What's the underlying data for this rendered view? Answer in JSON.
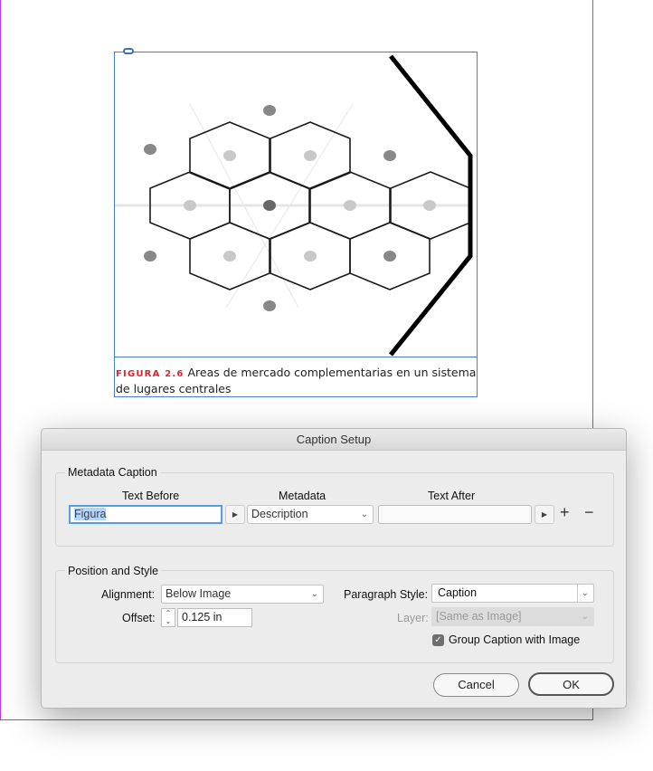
{
  "document": {
    "caption_label": "FIGURA 2.6",
    "caption_text": "Areas de mercado complementarias en un sistema de lugares centrales",
    "guide_color": "#b43cf0",
    "frame_color": "#4a7fd0"
  },
  "dialog": {
    "title": "Caption Setup",
    "metadata_caption": {
      "legend": "Metadata Caption",
      "text_before_header": "Text Before",
      "metadata_header": "Metadata",
      "text_after_header": "Text After",
      "text_before_value": "Figura",
      "metadata_value": "Description",
      "text_after_value": "",
      "add_label": "+",
      "remove_label": "−"
    },
    "position_and_style": {
      "legend": "Position and Style",
      "alignment_label": "Alignment:",
      "alignment_value": "Below Image",
      "offset_label": "Offset:",
      "offset_value": "0.125 in",
      "paragraph_style_label": "Paragraph Style:",
      "paragraph_style_value": "Caption",
      "layer_label": "Layer:",
      "layer_value": "[Same as Image]",
      "group_caption_label": "Group Caption with Image",
      "group_caption_checked": true
    },
    "cancel_label": "Cancel",
    "ok_label": "OK"
  }
}
